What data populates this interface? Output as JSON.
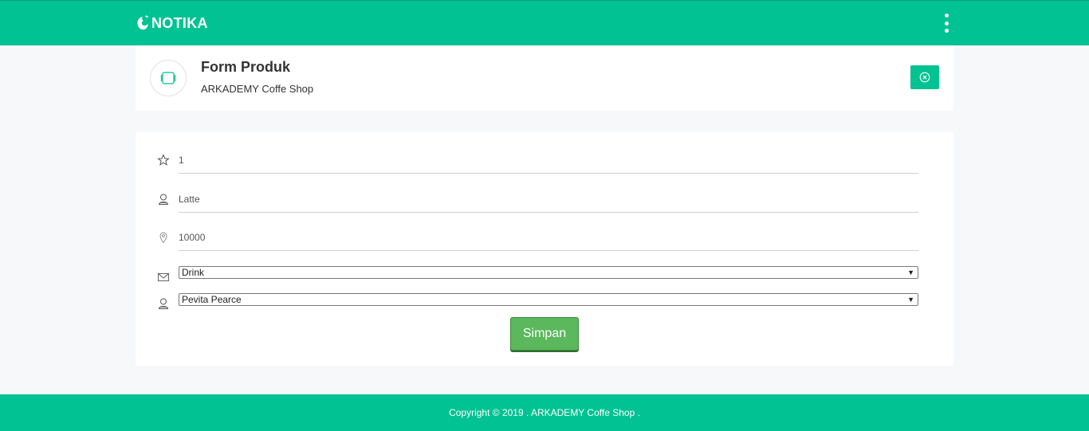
{
  "navbar": {
    "logo_text": "NOTIKA",
    "menu_icon": "vertical-dots-icon",
    "color": "#00c292"
  },
  "header": {
    "title": "Form Produk",
    "subtitle": "ARKADEMY Coffe Shop",
    "icon": "tablet-icon",
    "close_icon": "close-circle-icon"
  },
  "form": {
    "fields": [
      {
        "icon": "star-icon",
        "value": "1"
      },
      {
        "icon": "user-icon",
        "value": "Latte"
      },
      {
        "icon": "map-pin-icon",
        "value": "10000"
      }
    ],
    "selects": [
      {
        "icon": "mail-icon",
        "selected": "Drink"
      },
      {
        "icon": "user-icon",
        "selected": "Pevita Pearce"
      }
    ],
    "submit_label": "Simpan",
    "submit_color": "#5cb85c"
  },
  "footer": {
    "text": "Copyright © 2019 . ARKADEMY Coffe Shop ."
  }
}
